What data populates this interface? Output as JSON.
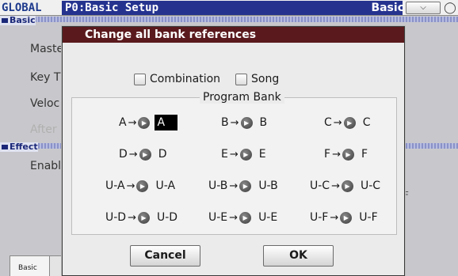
{
  "header": {
    "mode": "GLOBAL",
    "page": "P0:Basic Setup",
    "page_tab": "Basic",
    "menu_icon": "chevron-down-icon",
    "aux_icon": "power-icon"
  },
  "background": {
    "section_basic": "Basic",
    "labels": [
      "Maste",
      "Key T",
      "Veloc",
      "After"
    ],
    "section_effect": "Effect",
    "effect_label": "Enabl",
    "tab": "Basic",
    "stub": "F"
  },
  "dialog": {
    "title": "Change all bank references",
    "checkboxes": [
      {
        "label": "Combination",
        "checked": false
      },
      {
        "label": "Song",
        "checked": false
      }
    ],
    "group_title": "Program Bank",
    "mappings": [
      {
        "from": "A",
        "to": "A",
        "selected": true
      },
      {
        "from": "B",
        "to": "B",
        "selected": false
      },
      {
        "from": "C",
        "to": "C",
        "selected": false
      },
      {
        "from": "D",
        "to": "D",
        "selected": false
      },
      {
        "from": "E",
        "to": "E",
        "selected": false
      },
      {
        "from": "F",
        "to": "F",
        "selected": false
      },
      {
        "from": "U-A",
        "to": "U-A",
        "selected": false
      },
      {
        "from": "U-B",
        "to": "U-B",
        "selected": false
      },
      {
        "from": "U-C",
        "to": "U-C",
        "selected": false
      },
      {
        "from": "U-D",
        "to": "U-D",
        "selected": false
      },
      {
        "from": "U-E",
        "to": "U-E",
        "selected": false
      },
      {
        "from": "U-F",
        "to": "U-F",
        "selected": false
      }
    ],
    "arrow": "→",
    "popup_icon": "▶",
    "cancel_label": "Cancel",
    "ok_label": "OK"
  },
  "colors": {
    "title_bar": "#25338f",
    "dialog_title": "#5a1a1d",
    "selected": "#000000"
  }
}
